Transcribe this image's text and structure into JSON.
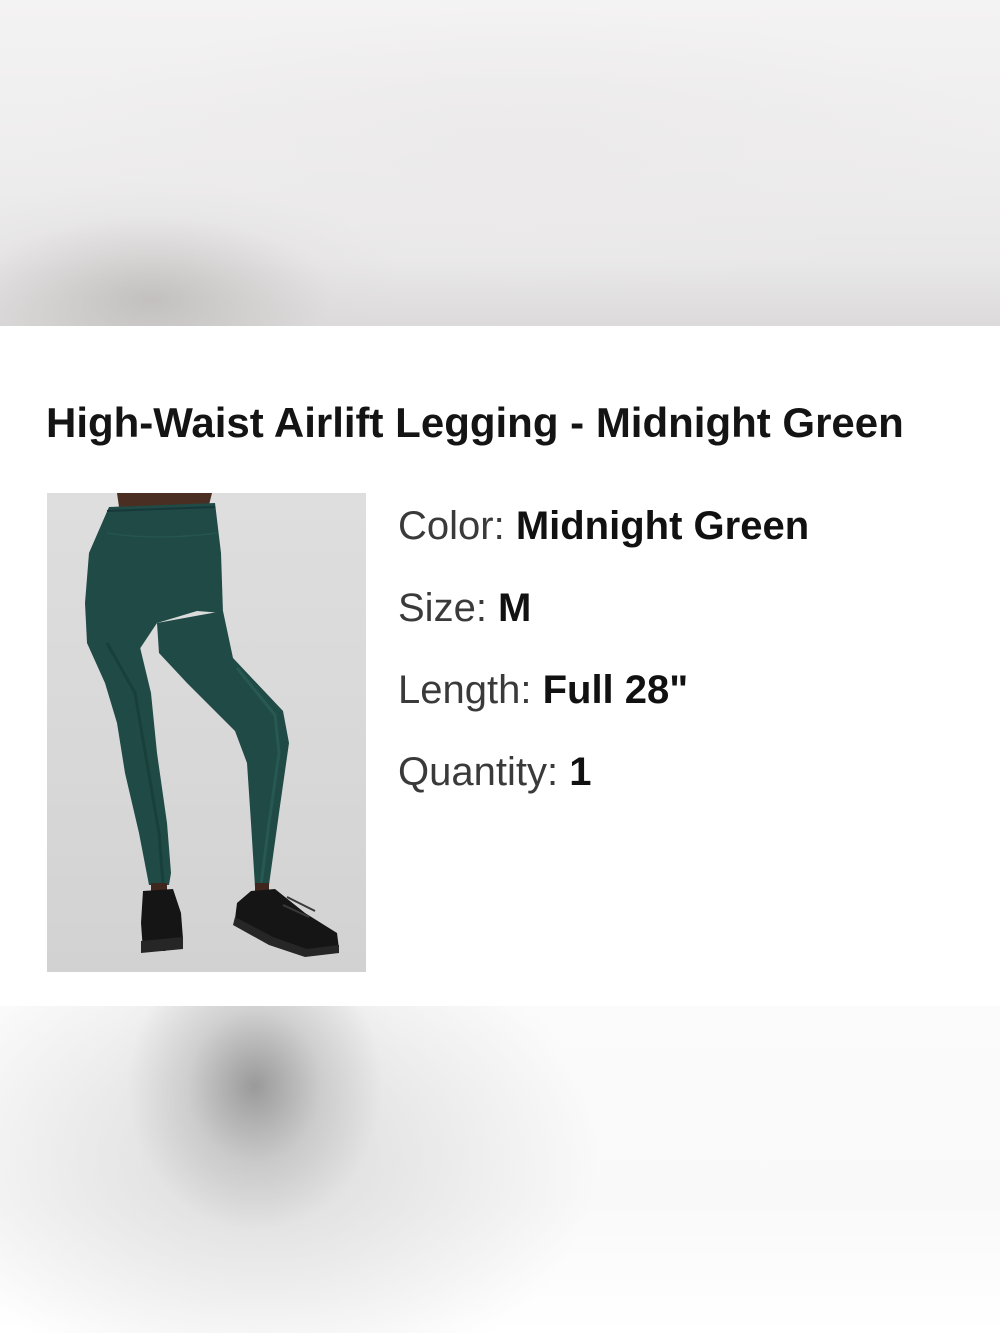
{
  "product": {
    "title": "High-Waist Airlift Legging - Midnight Green",
    "image_alt": "Midnight green high-waist leggings worn with black sneakers",
    "colors": {
      "legging": "#1f4a45",
      "sneaker": "#151515",
      "backdrop": "#d9d9d9"
    }
  },
  "details": [
    {
      "label": "Color: ",
      "value": "Midnight Green"
    },
    {
      "label": "Size: ",
      "value": "M"
    },
    {
      "label": "Length: ",
      "value": "Full 28\""
    },
    {
      "label": "Quantity: ",
      "value": "1"
    }
  ]
}
